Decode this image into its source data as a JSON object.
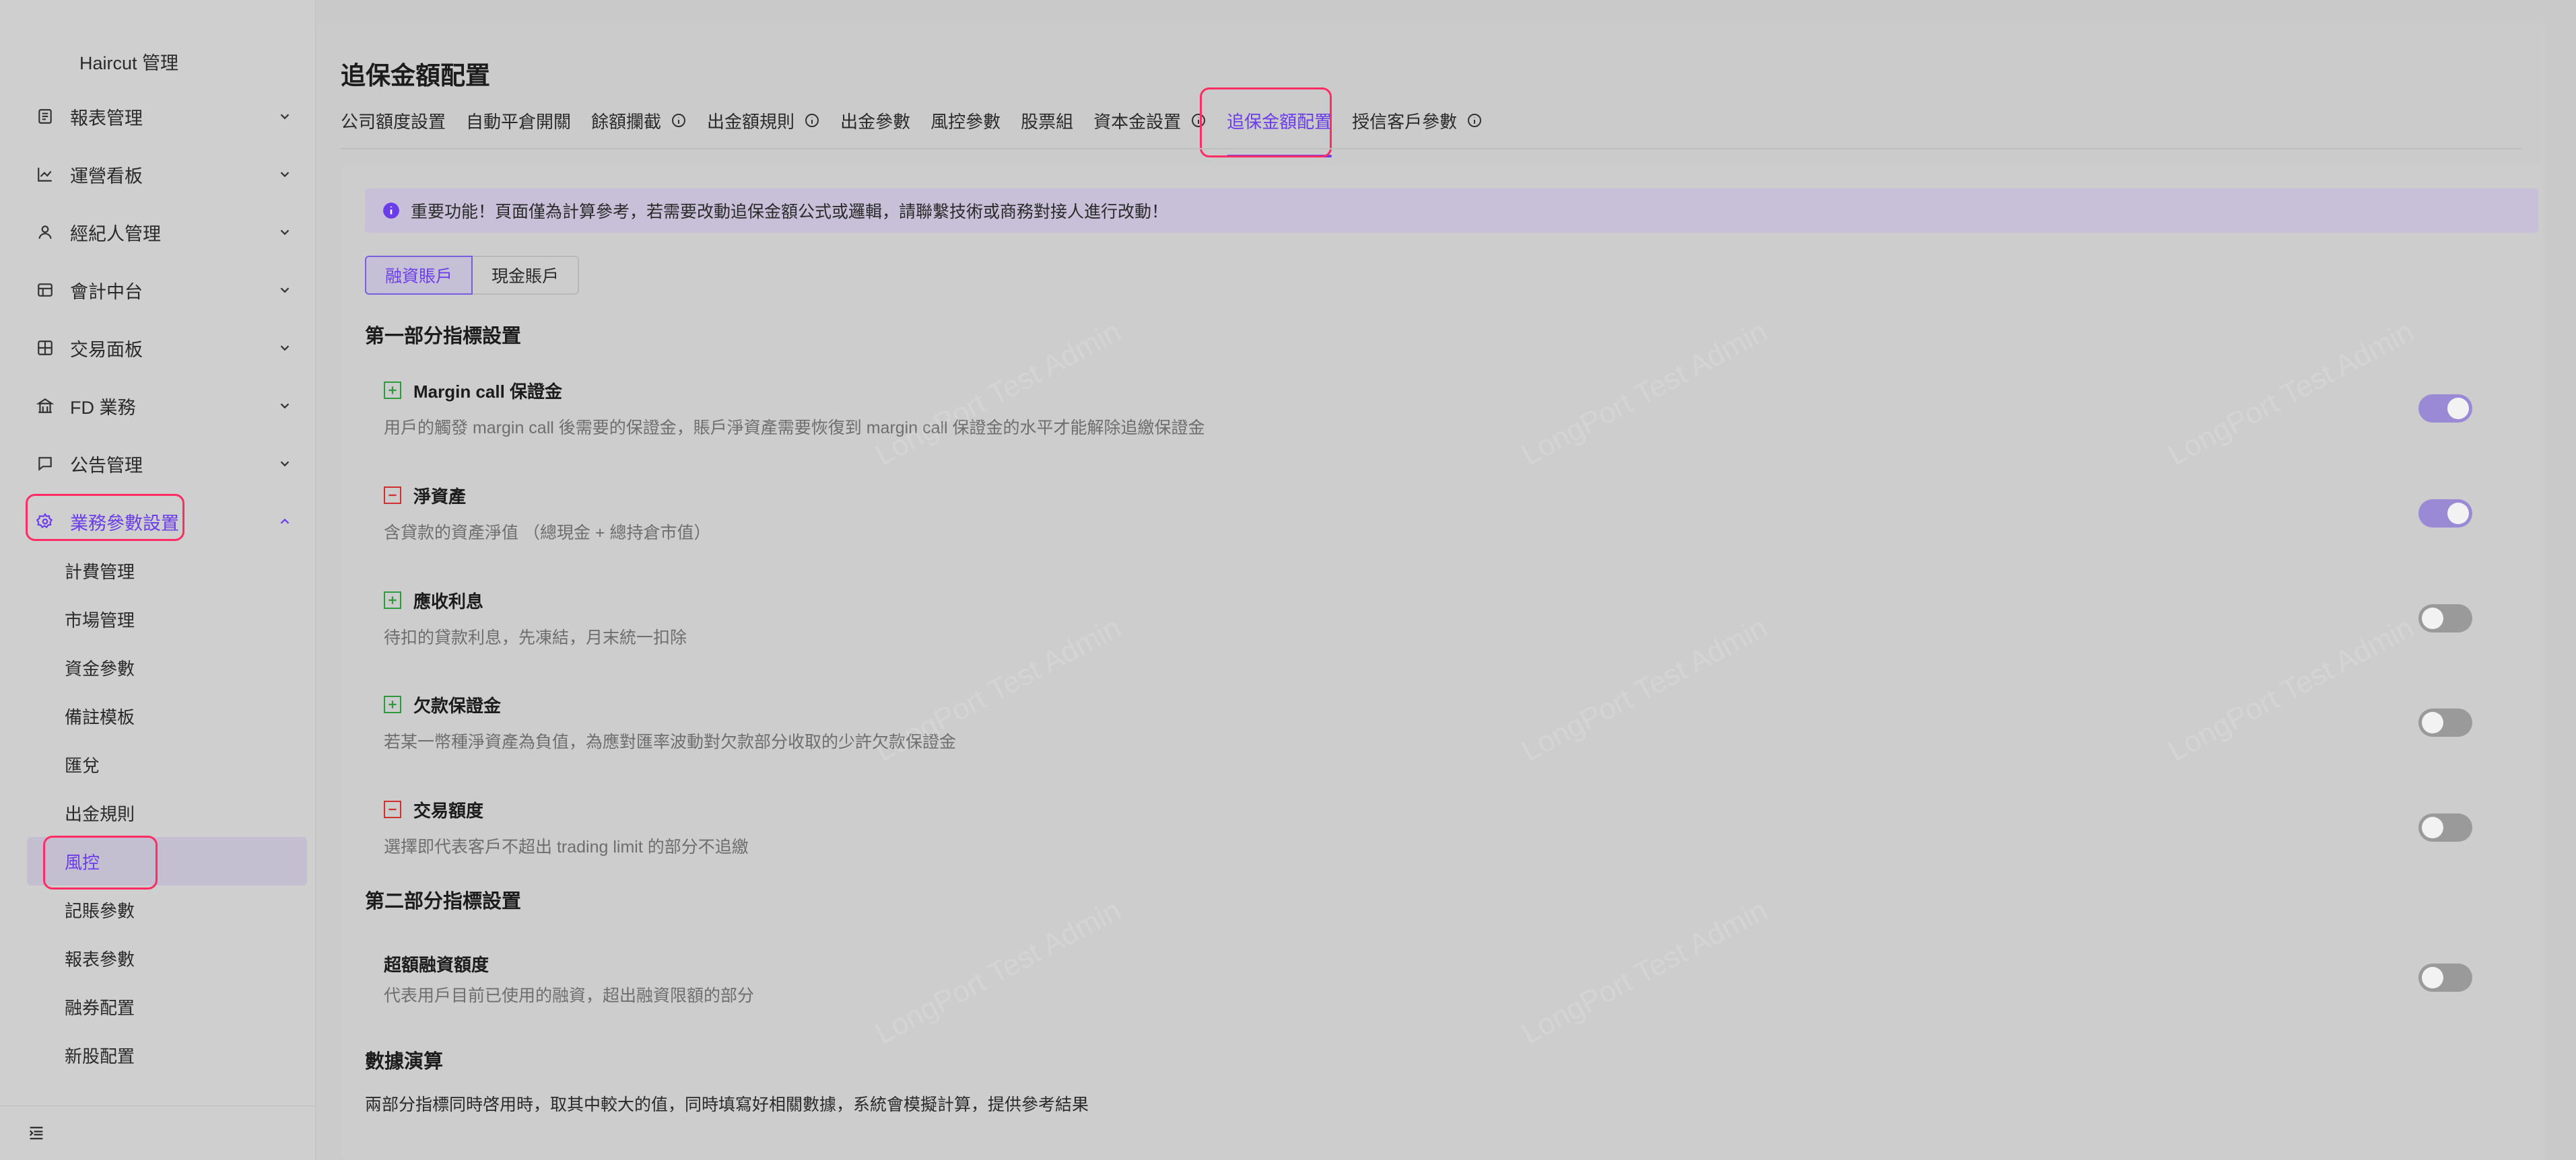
{
  "sidebar": {
    "top_item": "Haircut 管理",
    "menu": [
      {
        "label": "報表管理",
        "icon": "report-icon",
        "name": "report"
      },
      {
        "label": "運營看板",
        "icon": "chart-icon",
        "name": "ops-dashboard"
      },
      {
        "label": "經紀人管理",
        "icon": "user-icon",
        "name": "broker"
      },
      {
        "label": "會計中台",
        "icon": "ledger-icon",
        "name": "accounting"
      },
      {
        "label": "交易面板",
        "icon": "grid-icon",
        "name": "trading-panel"
      },
      {
        "label": "FD 業務",
        "icon": "bank-icon",
        "name": "fd-business"
      },
      {
        "label": "公告管理",
        "icon": "message-icon",
        "name": "announcement"
      },
      {
        "label": "業務參數設置",
        "icon": "settings-icon",
        "name": "business-params"
      }
    ],
    "submenu": [
      "計費管理",
      "市場管理",
      "資金參數",
      "備註模板",
      "匯兌",
      "出金規則",
      "風控",
      "記賬參數",
      "報表參數",
      "融券配置",
      "新股配置"
    ]
  },
  "page": {
    "title": "追保金額配置",
    "tabs": [
      {
        "label": "公司額度設置",
        "info": false
      },
      {
        "label": "自動平倉開關",
        "info": false
      },
      {
        "label": "餘額攔截",
        "info": true
      },
      {
        "label": "出金額規則",
        "info": true
      },
      {
        "label": "出金參數",
        "info": false
      },
      {
        "label": "風控參數",
        "info": false
      },
      {
        "label": "股票組",
        "info": false
      },
      {
        "label": "資本金設置",
        "info": true
      },
      {
        "label": "追保金額配置",
        "info": false,
        "active": true
      },
      {
        "label": "授信客戶參數",
        "info": true
      }
    ],
    "alert": "重要功能！頁面僅為計算參考，若需要改動追保金額公式或邏輯，請聯繫技術或商務對接人進行改動！",
    "segment": {
      "left": "融資賬戶",
      "right": "現金賬戶"
    },
    "section1_title": "第一部分指標設置",
    "items1": [
      {
        "sign": "plus",
        "title": "Margin call 保證金",
        "desc": "用戶的觸發 margin call 後需要的保證金，賬戶淨資產需要恢復到 margin call 保證金的水平才能解除追繳保證金",
        "enabled": true
      },
      {
        "sign": "minus",
        "title": "淨資產",
        "desc": "含貸款的資產淨值 （總現金 + 總持倉市值）",
        "enabled": true
      },
      {
        "sign": "plus",
        "title": "應收利息",
        "desc": "待扣的貸款利息，先凍結，月末統一扣除",
        "enabled": false
      },
      {
        "sign": "plus",
        "title": "欠款保證金",
        "desc": "若某一幣種淨資產為負值，為應對匯率波動對欠款部分收取的少許欠款保證金",
        "enabled": false
      },
      {
        "sign": "minus",
        "title": "交易額度",
        "desc": "選擇即代表客戶不超出 trading limit 的部分不追繳",
        "enabled": false
      }
    ],
    "section2_title": "第二部分指標設置",
    "items2": [
      {
        "title": "超額融資額度",
        "desc": "代表用戶目前已使用的融資，超出融資限額的部分",
        "enabled": false
      }
    ],
    "section3_title": "數據演算",
    "section3_desc": "兩部分指標同時啓用時，取其中較大的值，同時填寫好相關數據，系統會模擬計算，提供參考結果"
  },
  "watermark": "LongPort Test Admin",
  "colors": {
    "accent": "#6a3de8",
    "highlight": "#ff2d63",
    "plus": "#2e9a3e",
    "minus": "#d03030"
  }
}
